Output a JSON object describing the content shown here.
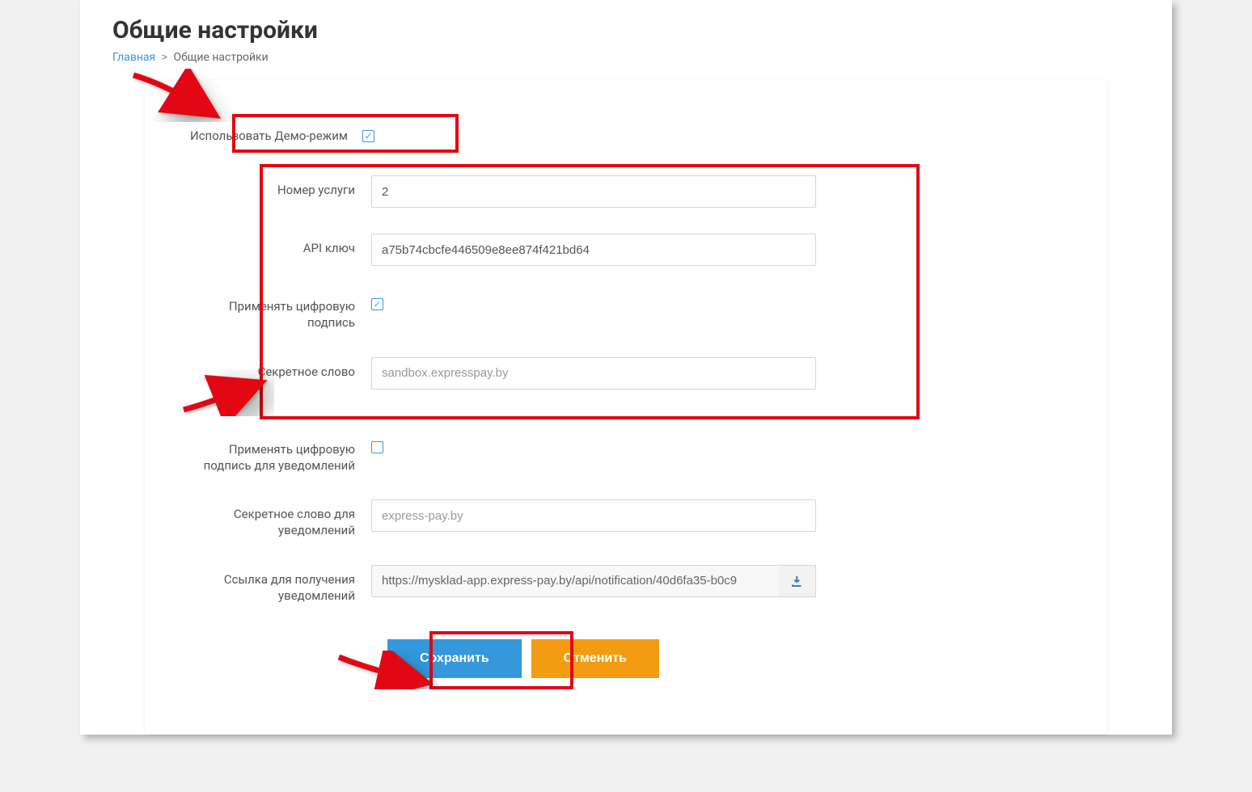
{
  "header": {
    "title": "Общие настройки",
    "breadcrumb_home": "Главная",
    "breadcrumb_current": "Общие настройки",
    "sep": ">"
  },
  "form": {
    "demo_label": "Использовать Демо-режим",
    "demo_checked": true,
    "service_number_label": "Номер услуги",
    "service_number_value": "2",
    "api_key_label": "API ключ",
    "api_key_value": "a75b74cbcfe446509e8ee874f421bd64",
    "sign_label": "Применять цифровую подпись",
    "sign_checked": true,
    "secret_label": "Секретное слово",
    "secret_placeholder": "sandbox.expresspay.by",
    "notify_sign_label": "Применять цифровую подпись для уведомлений",
    "notify_sign_checked": false,
    "notify_secret_label": "Секретное слово для уведомлений",
    "notify_secret_placeholder": "express-pay.by",
    "notify_url_label": "Ссылка для получения уведомлений",
    "notify_url_value": "https://mysklad-app.express-pay.by/api/notification/40d6fa35-b0c9"
  },
  "buttons": {
    "save": "Сохранить",
    "cancel": "Отменить"
  }
}
